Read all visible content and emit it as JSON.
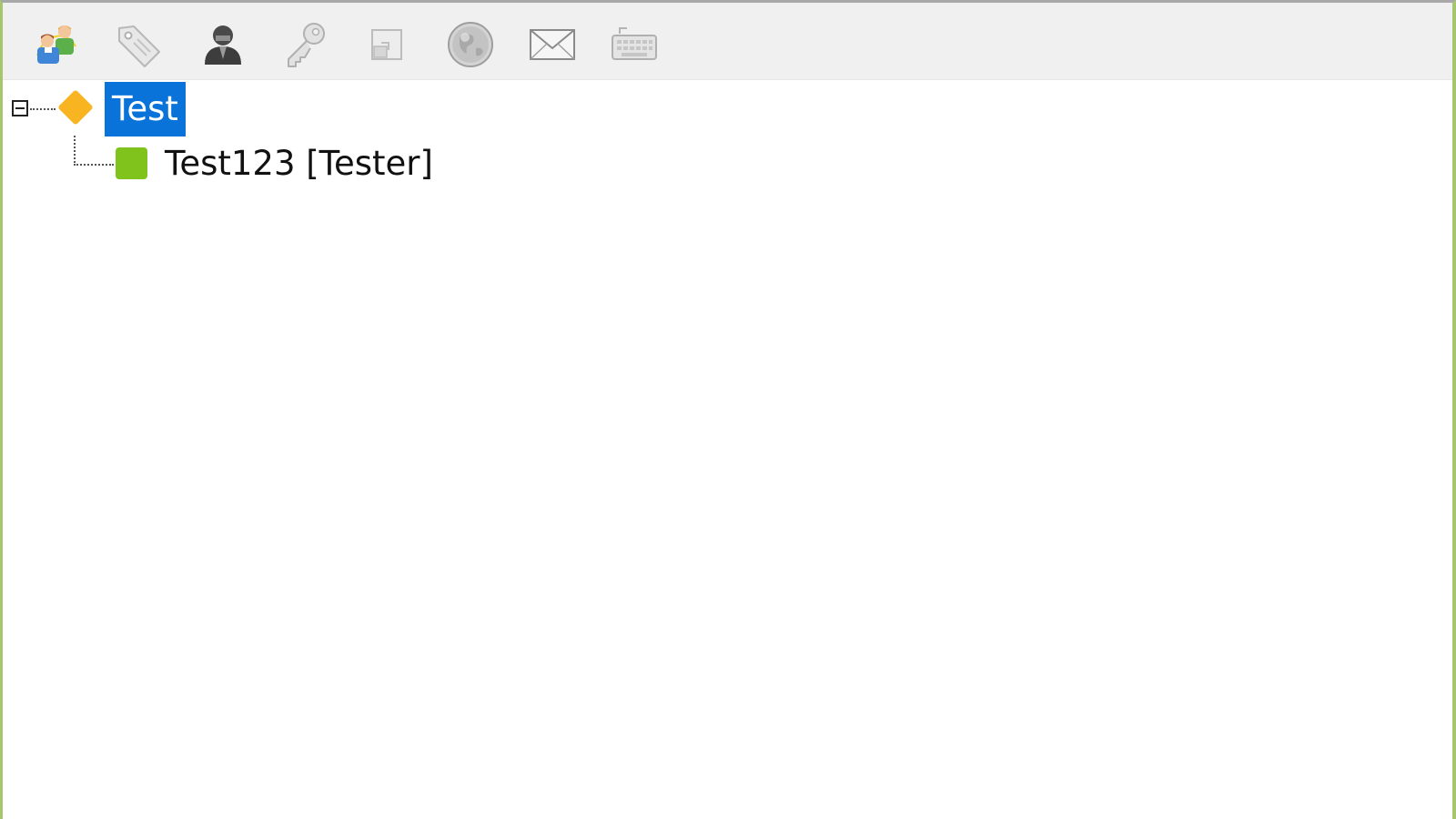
{
  "toolbar": {
    "buttons": [
      {
        "icon": "users-icon",
        "enabled": true
      },
      {
        "icon": "tag-icon",
        "enabled": false
      },
      {
        "icon": "user-icon",
        "enabled": true
      },
      {
        "icon": "key-icon",
        "enabled": false
      },
      {
        "icon": "window-icon",
        "enabled": false
      },
      {
        "icon": "globe-icon",
        "enabled": false
      },
      {
        "icon": "mail-icon",
        "enabled": false
      },
      {
        "icon": "keyboard-icon",
        "enabled": false
      }
    ]
  },
  "tree": {
    "root": {
      "label": "Test",
      "selected": true,
      "expanded": true,
      "icon": "diamond-icon",
      "icon_color": "#f8b521"
    },
    "children": [
      {
        "label": "Test123 [Tester]",
        "icon": "square-status-icon",
        "icon_color": "#7fc31c"
      }
    ]
  },
  "colors": {
    "selection": "#0a73d9",
    "frame": "#a5c66e",
    "toolbar_bg": "#f0f0f0"
  }
}
